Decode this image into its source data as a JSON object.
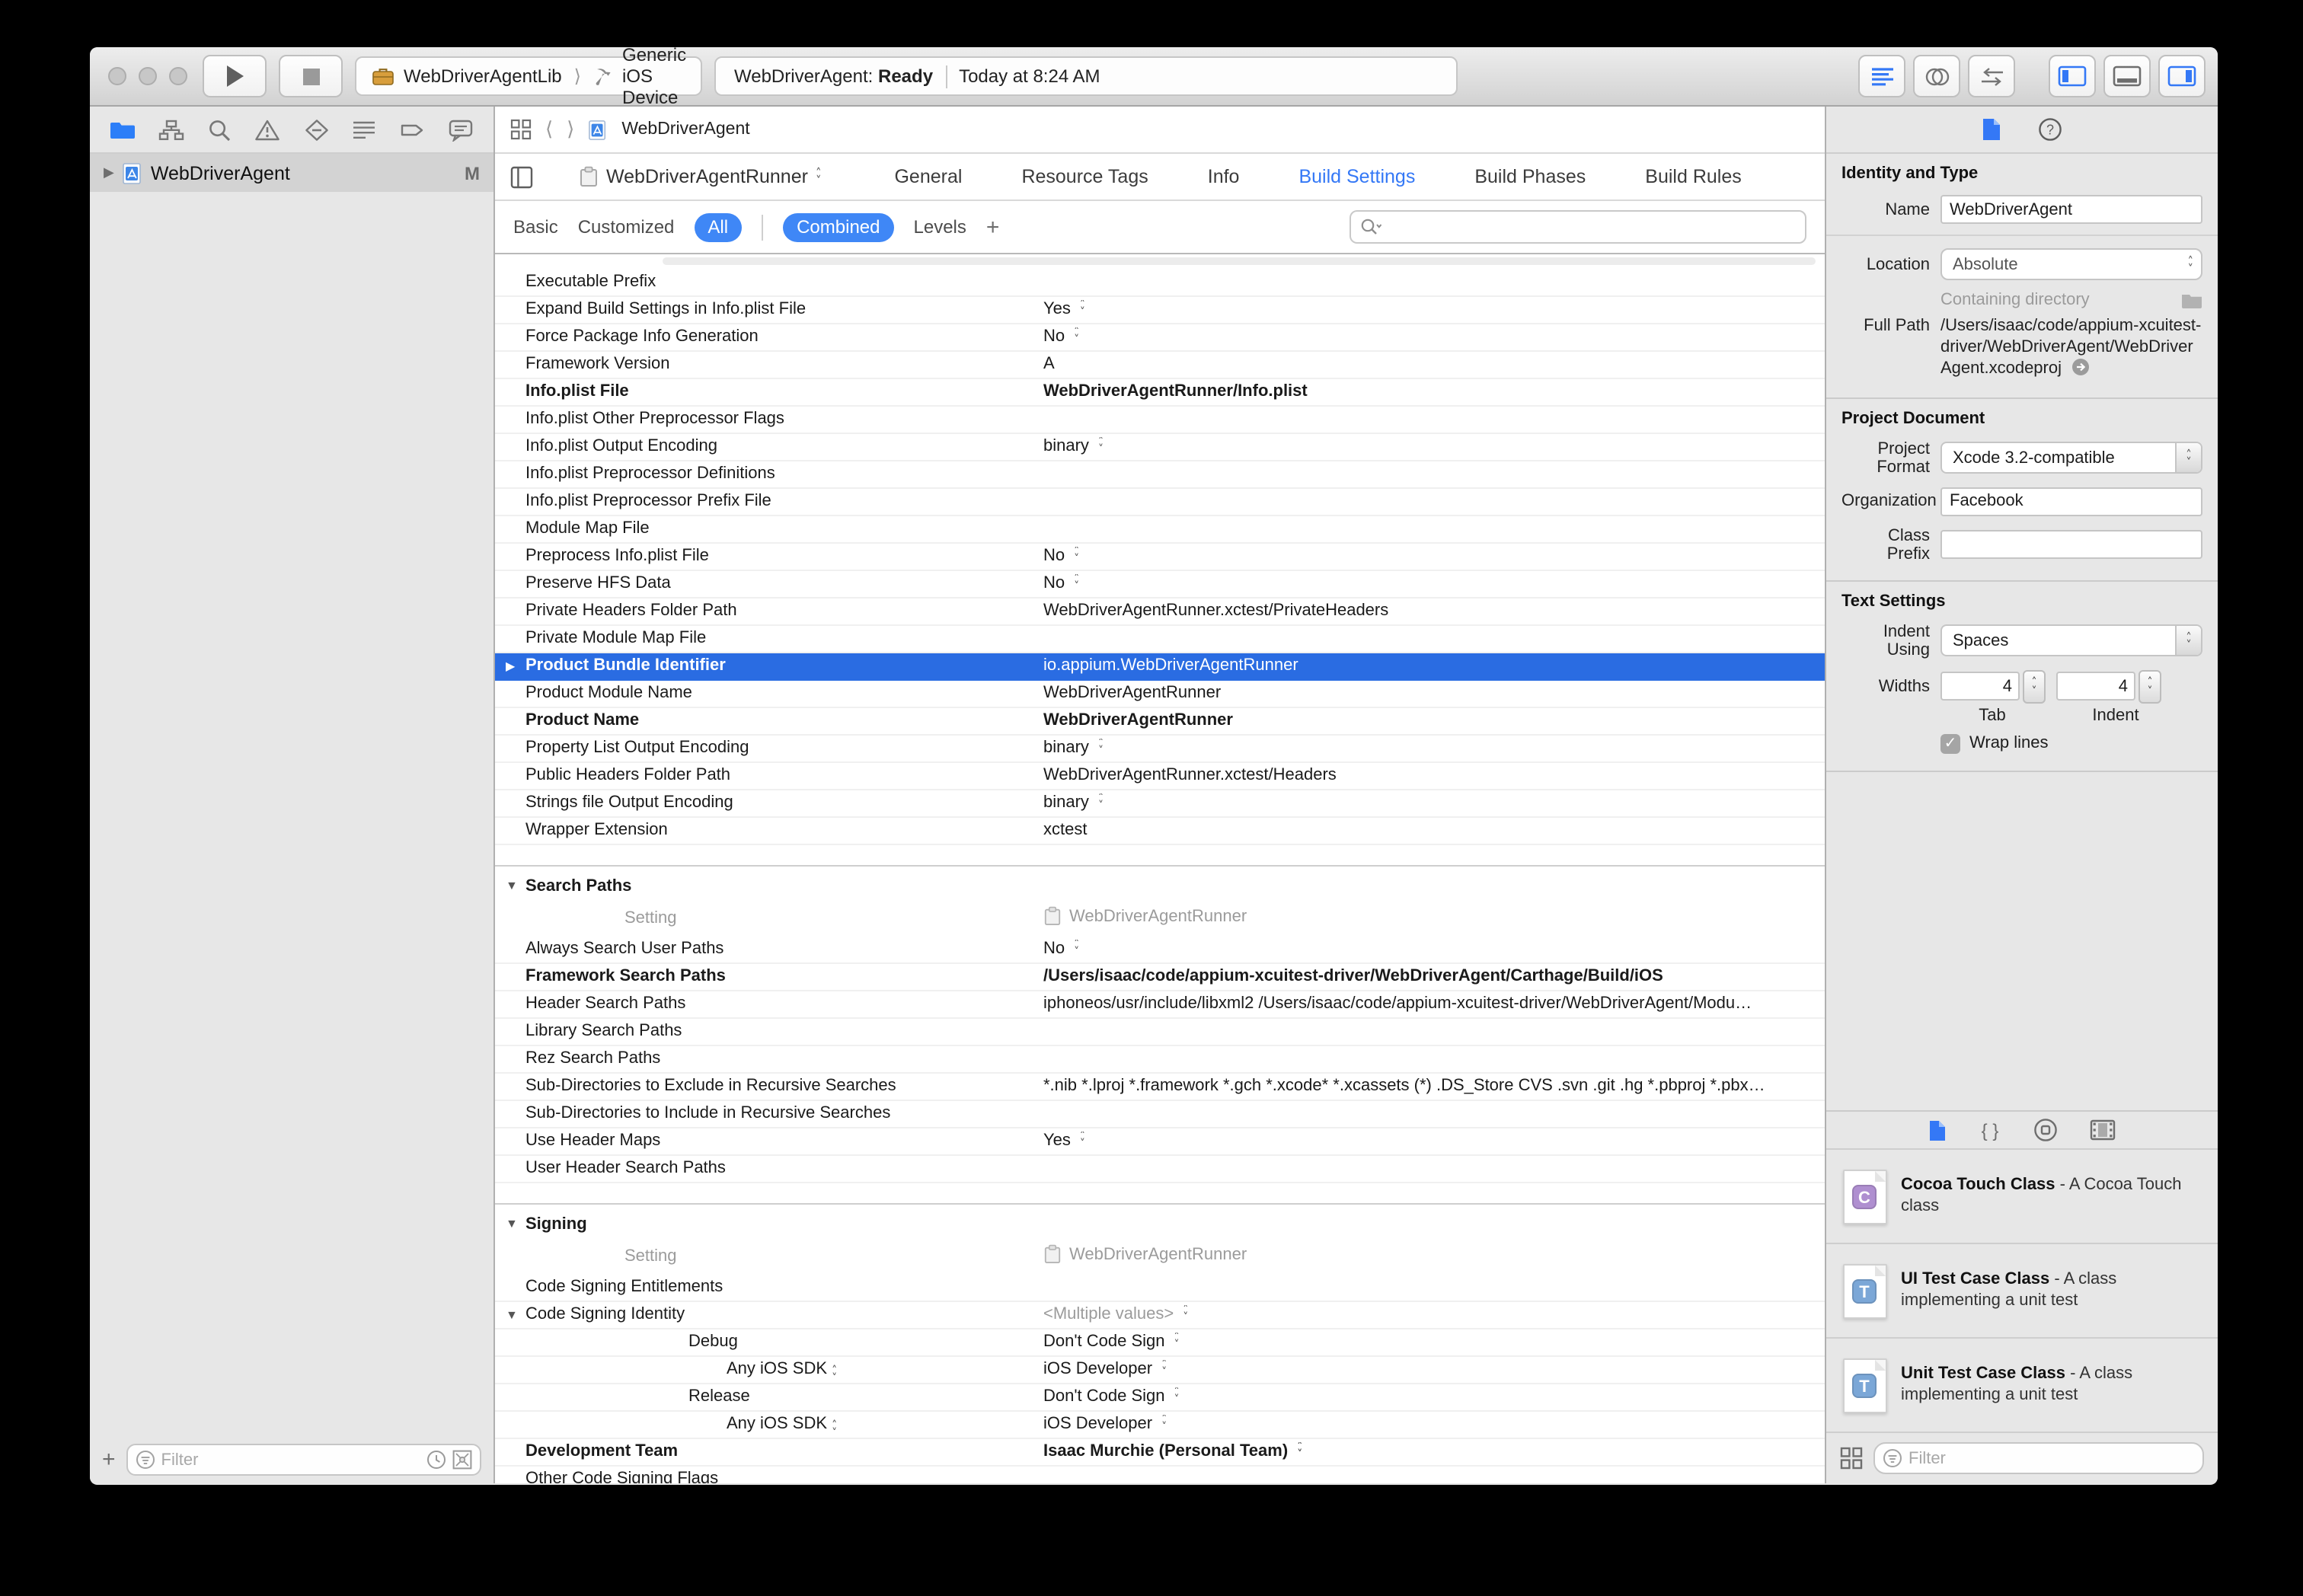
{
  "toolbar": {
    "scheme_target": "WebDriverAgentLib",
    "scheme_destination": "Generic iOS Device",
    "status_project": "WebDriverAgent:",
    "status_state": "Ready",
    "status_time": "Today at 8:24 AM"
  },
  "navigator": {
    "project_name": "WebDriverAgent",
    "badge": "M",
    "filter_placeholder": "Filter"
  },
  "editor": {
    "jumpbar_title": "WebDriverAgent",
    "target_name": "WebDriverAgentRunner",
    "tabs": [
      "General",
      "Resource Tags",
      "Info",
      "Build Settings",
      "Build Phases",
      "Build Rules"
    ],
    "active_tab": "Build Settings",
    "scopes": [
      "Basic",
      "Customized",
      "All",
      "Combined",
      "Levels"
    ],
    "active_scopes": [
      "All",
      "Combined"
    ],
    "column_header": {
      "setting": "Setting",
      "target": "WebDriverAgentRunner"
    },
    "sections": [
      {
        "title": null,
        "rows": [
          {
            "label": "Executable Prefix"
          },
          {
            "label": "Expand Build Settings in Info.plist File",
            "value": "Yes",
            "stepper": true
          },
          {
            "label": "Force Package Info Generation",
            "value": "No",
            "stepper": true
          },
          {
            "label": "Framework Version",
            "value": "A"
          },
          {
            "label": "Info.plist File",
            "bold": true,
            "value": "WebDriverAgentRunner/Info.plist"
          },
          {
            "label": "Info.plist Other Preprocessor Flags"
          },
          {
            "label": "Info.plist Output Encoding",
            "value": "binary",
            "stepper": true
          },
          {
            "label": "Info.plist Preprocessor Definitions"
          },
          {
            "label": "Info.plist Preprocessor Prefix File"
          },
          {
            "label": "Module Map File"
          },
          {
            "label": "Preprocess Info.plist File",
            "value": "No",
            "stepper": true
          },
          {
            "label": "Preserve HFS Data",
            "value": "No",
            "stepper": true
          },
          {
            "label": "Private Headers Folder Path",
            "value": "WebDriverAgentRunner.xctest/PrivateHeaders"
          },
          {
            "label": "Private Module Map File"
          },
          {
            "label": "Product Bundle Identifier",
            "selected": true,
            "disclosure": "right",
            "value": "io.appium.WebDriverAgentRunner"
          },
          {
            "label": "Product Module Name",
            "value": "WebDriverAgentRunner"
          },
          {
            "label": "Product Name",
            "bold": true,
            "value": "WebDriverAgentRunner"
          },
          {
            "label": "Property List Output Encoding",
            "value": "binary",
            "stepper": true
          },
          {
            "label": "Public Headers Folder Path",
            "value": "WebDriverAgentRunner.xctest/Headers"
          },
          {
            "label": "Strings file Output Encoding",
            "value": "binary",
            "stepper": true
          },
          {
            "label": "Wrapper Extension",
            "value": "xctest"
          }
        ]
      },
      {
        "title": "Search Paths",
        "rows": [
          {
            "label": "Always Search User Paths",
            "value": "No",
            "stepper": true
          },
          {
            "label": "Framework Search Paths",
            "bold": true,
            "value": "/Users/isaac/code/appium-xcuitest-driver/WebDriverAgent/Carthage/Build/iOS"
          },
          {
            "label": "Header Search Paths",
            "value": "iphoneos/usr/include/libxml2 /Users/isaac/code/appium-xcuitest-driver/WebDriverAgent/Modu…"
          },
          {
            "label": "Library Search Paths"
          },
          {
            "label": "Rez Search Paths"
          },
          {
            "label": "Sub-Directories to Exclude in Recursive Searches",
            "value": "*.nib *.lproj *.framework *.gch *.xcode* *.xcassets (*) .DS_Store CVS .svn .git .hg *.pbproj *.pbx…"
          },
          {
            "label": "Sub-Directories to Include in Recursive Searches"
          },
          {
            "label": "Use Header Maps",
            "value": "Yes",
            "stepper": true
          },
          {
            "label": "User Header Search Paths"
          }
        ]
      },
      {
        "title": "Signing",
        "rows": [
          {
            "label": "Code Signing Entitlements"
          },
          {
            "label": "Code Signing Identity",
            "disclosure": "down",
            "value": "<Multiple values>",
            "stepper": true,
            "gray": true
          },
          {
            "label": "Debug",
            "indent": 1,
            "value": "Don't Code Sign",
            "stepper": true
          },
          {
            "label": "Any iOS SDK",
            "indent": 2,
            "label_stepper": true,
            "value": "iOS Developer",
            "stepper": true
          },
          {
            "label": "Release",
            "indent": 1,
            "value": "Don't Code Sign",
            "stepper": true
          },
          {
            "label": "Any iOS SDK",
            "indent": 2,
            "label_stepper": true,
            "value": "iOS Developer",
            "stepper": true
          },
          {
            "label": "Development Team",
            "bold": true,
            "value": "Isaac Murchie (Personal Team)",
            "stepper": true
          },
          {
            "label": "Other Code Signing Flags"
          }
        ]
      }
    ]
  },
  "inspector": {
    "identity": {
      "title": "Identity and Type",
      "name_label": "Name",
      "name_value": "WebDriverAgent",
      "location_label": "Location",
      "location_value": "Absolute",
      "containing_dir": "Containing directory",
      "full_path_label": "Full Path",
      "full_path": "/Users/isaac/code/appium-xcuitest-driver/WebDriverAgent/WebDriverAgent.xcodeproj"
    },
    "project_document": {
      "title": "Project Document",
      "format_label": "Project Format",
      "format_value": "Xcode 3.2-compatible",
      "org_label": "Organization",
      "org_value": "Facebook",
      "class_prefix_label": "Class Prefix",
      "class_prefix_value": ""
    },
    "text_settings": {
      "title": "Text Settings",
      "indent_label": "Indent Using",
      "indent_value": "Spaces",
      "widths_label": "Widths",
      "tab_width": "4",
      "indent_width": "4",
      "tab_caption": "Tab",
      "indent_caption": "Indent",
      "wrap_label": "Wrap lines",
      "wrap_checked": "✓"
    }
  },
  "library": {
    "items": [
      {
        "name": "Cocoa Touch Class",
        "desc": "A Cocoa Touch class",
        "letter": "C",
        "color": "#af8fd0"
      },
      {
        "name": "UI Test Case Class",
        "desc": "A class implementing a unit test",
        "letter": "T",
        "color": "#7ba7d7"
      },
      {
        "name": "Unit Test Case Class",
        "desc": "A class implementing a unit test",
        "letter": "T",
        "color": "#7ba7d7"
      }
    ],
    "filter_placeholder": "Filter"
  },
  "colors": {
    "accent_blue": "#3f87f6",
    "selection_blue": "#2a6ce2",
    "active_tab_blue": "#3478f6"
  }
}
